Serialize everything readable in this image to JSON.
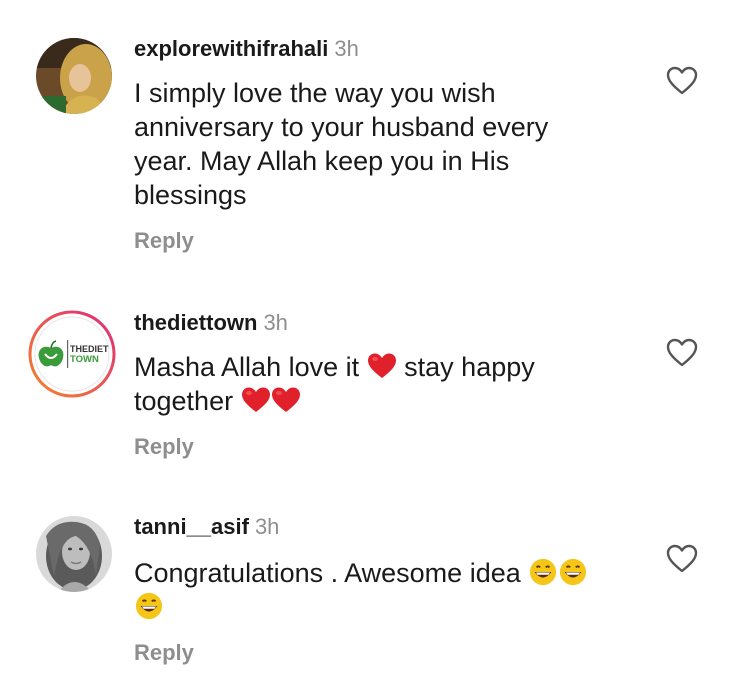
{
  "comments": [
    {
      "username": "explorewithifrahali",
      "time": "3h",
      "text": "I simply love the way you wish anniversary to your husband every year. May Allah keep you in His blessings",
      "reply": "Reply",
      "avatar_icon": "woman-hijab-avatar"
    },
    {
      "username": "thediettown",
      "time": "3h",
      "text_before": "Masha Allah love it",
      "text_middle": "stay happy together",
      "reply": "Reply",
      "avatar_icon": "thediettown-logo",
      "logo_text_top": "THEDIET",
      "logo_text_bottom": "TOWN"
    },
    {
      "username": "tanni__asif",
      "time": "3h",
      "text": "Congratulations . Awesome idea",
      "reply": "Reply",
      "avatar_icon": "woman-portrait-avatar"
    }
  ],
  "colors": {
    "time": "#8e8e8e",
    "reply": "#8e8e8e",
    "heart_emoji": "#e0202a",
    "story_ring_start": "#f58529",
    "story_ring_end": "#dd2a7b"
  }
}
